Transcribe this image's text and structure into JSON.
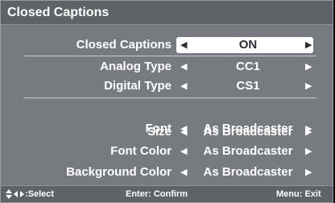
{
  "title": "Closed Captions",
  "rows": [
    {
      "label": "Closed Captions",
      "value": "ON",
      "left_arrow": "◀",
      "right_arrow": "▶"
    },
    {
      "label": "Analog Type",
      "value": "CC1",
      "left_arrow": "◀",
      "right_arrow": "▶"
    },
    {
      "label": "Digital Type",
      "value": "CS1",
      "left_arrow": "◀",
      "right_arrow": "▶"
    },
    {
      "label": "Font",
      "value": "As Broadcaster",
      "left_arrow": "◀",
      "right_arrow": "▶"
    },
    {
      "label": "Size",
      "value": "As Broadcaster",
      "left_arrow": "◀",
      "right_arrow": "▶"
    },
    {
      "label": "Font Color",
      "value": "As Broadcaster",
      "left_arrow": "◀",
      "right_arrow": "▶"
    },
    {
      "label": "Background Color",
      "value": "As Broadcaster",
      "left_arrow": "◀",
      "right_arrow": "▶"
    }
  ],
  "footer": {
    "select": ":Select",
    "confirm": "Enter: Confirm",
    "exit": "Menu: Exit"
  }
}
